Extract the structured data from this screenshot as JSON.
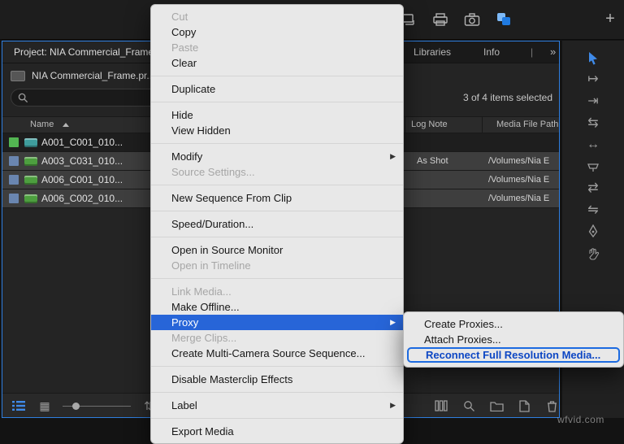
{
  "top_bar": {
    "plus": "+"
  },
  "project_panel": {
    "active_tab": "Project: NIA Commercial_Frame",
    "tab_libraries": "Libraries",
    "tab_info": "Info",
    "tab_separator": "|",
    "tab_overflow": "»",
    "project_file": "NIA Commercial_Frame.pr...",
    "selection_status": "3 of 4 items selected",
    "columns": {
      "name": "Name",
      "log_note": "Log Note",
      "media_file_path": "Media File Path"
    },
    "rows": [
      {
        "name": "A001_C001_010...",
        "log_note": "",
        "media_file_path": "",
        "label_color": "#53b552",
        "selected": false
      },
      {
        "name": "A003_C031_010...",
        "log_note": "As Shot",
        "media_file_path": "/Volumes/Nia E",
        "label_color": "#6a86b0",
        "selected": true
      },
      {
        "name": "A006_C001_010...",
        "log_note": "",
        "media_file_path": "/Volumes/Nia E",
        "label_color": "#6a86b0",
        "selected": true
      },
      {
        "name": "A006_C002_010...",
        "log_note": "",
        "media_file_path": "/Volumes/Nia E",
        "label_color": "#6a86b0",
        "selected": true
      }
    ]
  },
  "context_menu": {
    "submenu_arrow": "▶",
    "items": [
      {
        "label": "Cut",
        "disabled": true
      },
      {
        "label": "Copy"
      },
      {
        "label": "Paste",
        "disabled": true
      },
      {
        "label": "Clear"
      },
      {
        "label": "Duplicate"
      },
      {
        "label": "Hide"
      },
      {
        "label": "View Hidden"
      },
      {
        "label": "Modify",
        "submenu": true
      },
      {
        "label": "Source Settings...",
        "disabled": true
      },
      {
        "label": "New Sequence From Clip"
      },
      {
        "label": "Speed/Duration..."
      },
      {
        "label": "Open in Source Monitor"
      },
      {
        "label": "Open in Timeline",
        "disabled": true
      },
      {
        "label": "Link Media...",
        "disabled": true
      },
      {
        "label": "Make Offline..."
      },
      {
        "label": "Proxy",
        "submenu": true,
        "highlighted": true
      },
      {
        "label": "Merge Clips...",
        "disabled": true
      },
      {
        "label": "Create Multi-Camera Source Sequence..."
      },
      {
        "label": "Disable Masterclip Effects"
      },
      {
        "label": "Label",
        "submenu": true
      },
      {
        "label": "Export Media"
      }
    ]
  },
  "proxy_submenu": {
    "items": [
      {
        "label": "Create Proxies..."
      },
      {
        "label": "Attach Proxies..."
      },
      {
        "label": "Reconnect Full Resolution Media...",
        "emphasized": true
      }
    ]
  },
  "tools_glyphs": {
    "track_select": "↦",
    "ripple_edit": "⇥",
    "rolling_edit": "⇆",
    "rate_stretch": "↔",
    "slip": "⇄",
    "slide": "⇋"
  },
  "misc_glyphs": {
    "grid_view": "▦",
    "zoom_steps": "⇅"
  },
  "colors": {
    "panel_focus_border": "#2f7fe0",
    "menu_highlight": "#2765d8",
    "submenu_emphasis": "#1c6ae0",
    "selection_tool_blue": "#3f8ae8",
    "label_green": "#53b552",
    "label_blue": "#6a86b0",
    "clip_icon_green": "#4d9f3f"
  },
  "watermark": "wfvid.com"
}
